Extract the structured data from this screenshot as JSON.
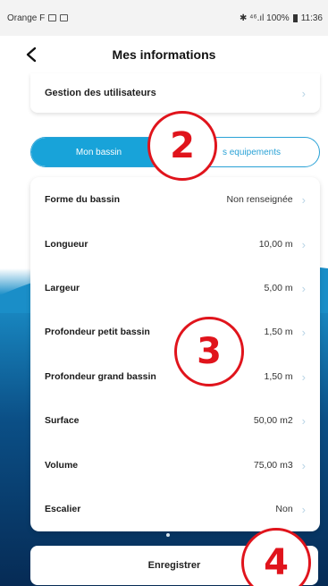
{
  "status_bar": {
    "carrier": "Orange F",
    "right": "✱ ⁴⁶.ıl 100%",
    "time": "11:36"
  },
  "header": {
    "title": "Mes informations"
  },
  "gestion": {
    "label": "Gestion des utilisateurs"
  },
  "tabs": [
    {
      "label": "Mon bassin",
      "active": true
    },
    {
      "label": "s equipements",
      "active": false
    }
  ],
  "rows": [
    {
      "label": "Forme du bassin",
      "value": "Non renseignée"
    },
    {
      "label": "Longueur",
      "value": "10,00 m"
    },
    {
      "label": "Largeur",
      "value": "5,00 m"
    },
    {
      "label": "Profondeur petit bassin",
      "value": "1,50 m"
    },
    {
      "label": "Profondeur grand bassin",
      "value": "1,50 m"
    },
    {
      "label": "Surface",
      "value": "50,00 m2"
    },
    {
      "label": "Volume",
      "value": "75,00 m3"
    },
    {
      "label": "Escalier",
      "value": "Non"
    }
  ],
  "save_button": {
    "label": "Enregistrer"
  },
  "badges": [
    "2",
    "3",
    "4"
  ],
  "colors": {
    "accent": "#18a3d9",
    "badge_red": "#e0141c",
    "deep_blue": "#062b55"
  },
  "icons": {
    "back": "chevron-left-icon",
    "row_chevron": "chevron-right-icon"
  }
}
